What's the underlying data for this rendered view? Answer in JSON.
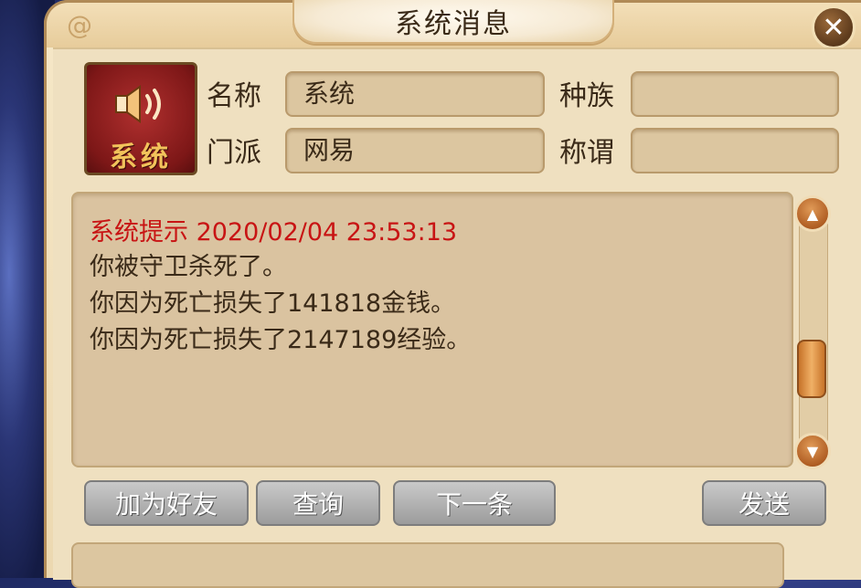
{
  "window": {
    "title": "系统消息",
    "close_icon": "close-icon"
  },
  "sender": {
    "avatar_label": "系统",
    "avatar_icon": "speaker-icon",
    "labels": {
      "name": "名称",
      "race": "种族",
      "sect": "门派",
      "title": "称谓"
    },
    "values": {
      "name": "系统",
      "race": "",
      "sect": "网易",
      "title": ""
    }
  },
  "message": {
    "header": "系统提示 2020/02/04 23:53:13",
    "lines": [
      "你被守卫杀死了。",
      "你因为死亡损失了141818金钱。",
      "你因为死亡损失了2147189经验。"
    ]
  },
  "actions": {
    "add_friend": "加为好友",
    "query": "查询",
    "next": "下一条",
    "send": "发送"
  },
  "colors": {
    "header_red": "#c81414",
    "panel": "#efe0c0",
    "avatar_red": "#9b2222"
  }
}
